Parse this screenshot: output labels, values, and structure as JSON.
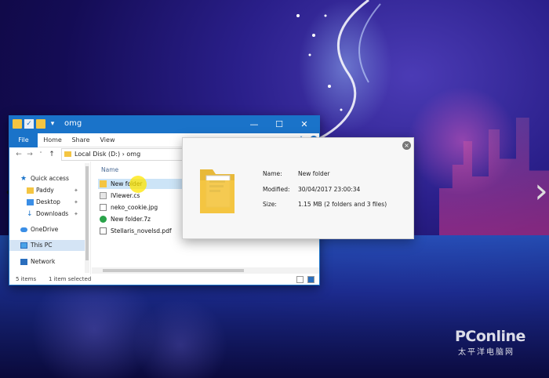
{
  "window": {
    "title": "omg",
    "controls": {
      "minimize": "—",
      "maximize": "☐",
      "close": "✕"
    }
  },
  "ribbon": {
    "tabs": [
      "File",
      "Home",
      "Share",
      "View"
    ],
    "expand": "˅",
    "help": "?"
  },
  "nav": {
    "back": "←",
    "forward": "→",
    "recent": "˅",
    "up": "↑",
    "address_path": "Local Disk (D:) › omg"
  },
  "sidebar": {
    "items": [
      {
        "label": "Quick access",
        "icon": "star-icon"
      },
      {
        "label": "Paddy",
        "icon": "folder-icon",
        "pinned": true
      },
      {
        "label": "Desktop",
        "icon": "desktop-icon",
        "pinned": true
      },
      {
        "label": "Downloads",
        "icon": "download-icon",
        "pinned": true
      },
      {
        "label": "OneDrive",
        "icon": "cloud-icon"
      },
      {
        "label": "This PC",
        "icon": "computer-icon",
        "selected": true
      },
      {
        "label": "Network",
        "icon": "network-icon"
      }
    ],
    "pin_glyph": "📌"
  },
  "file_list": {
    "column_name": "Name",
    "sort_caret": "^",
    "files": [
      {
        "name": "New folder",
        "icon": "folder-icon",
        "selected": true
      },
      {
        "name": "IViewer.cs",
        "icon": "code-file-icon"
      },
      {
        "name": "neko_cookie.jpg",
        "icon": "image-file-icon"
      },
      {
        "name": "New folder.7z",
        "icon": "archive-icon"
      },
      {
        "name": "Stellaris_novelsd.pdf",
        "icon": "pdf-icon"
      }
    ]
  },
  "status": {
    "count": "5 items",
    "selected": "1 item selected"
  },
  "preview": {
    "close": "×",
    "name_label": "Name:",
    "name_value": "New folder",
    "modified_label": "Modified:",
    "modified_value": "30/04/2017 23:00:34",
    "size_label": "Size:",
    "size_value": "1.15 MB (2 folders and 3 files)"
  },
  "slider": {
    "prev": "‹",
    "next": "›"
  },
  "watermark": {
    "brand": "PConline",
    "sub": "太平洋电脑网"
  },
  "colors": {
    "accent": "#1a73c9",
    "folder": "#f4c542",
    "selection": "#cce4f7"
  }
}
